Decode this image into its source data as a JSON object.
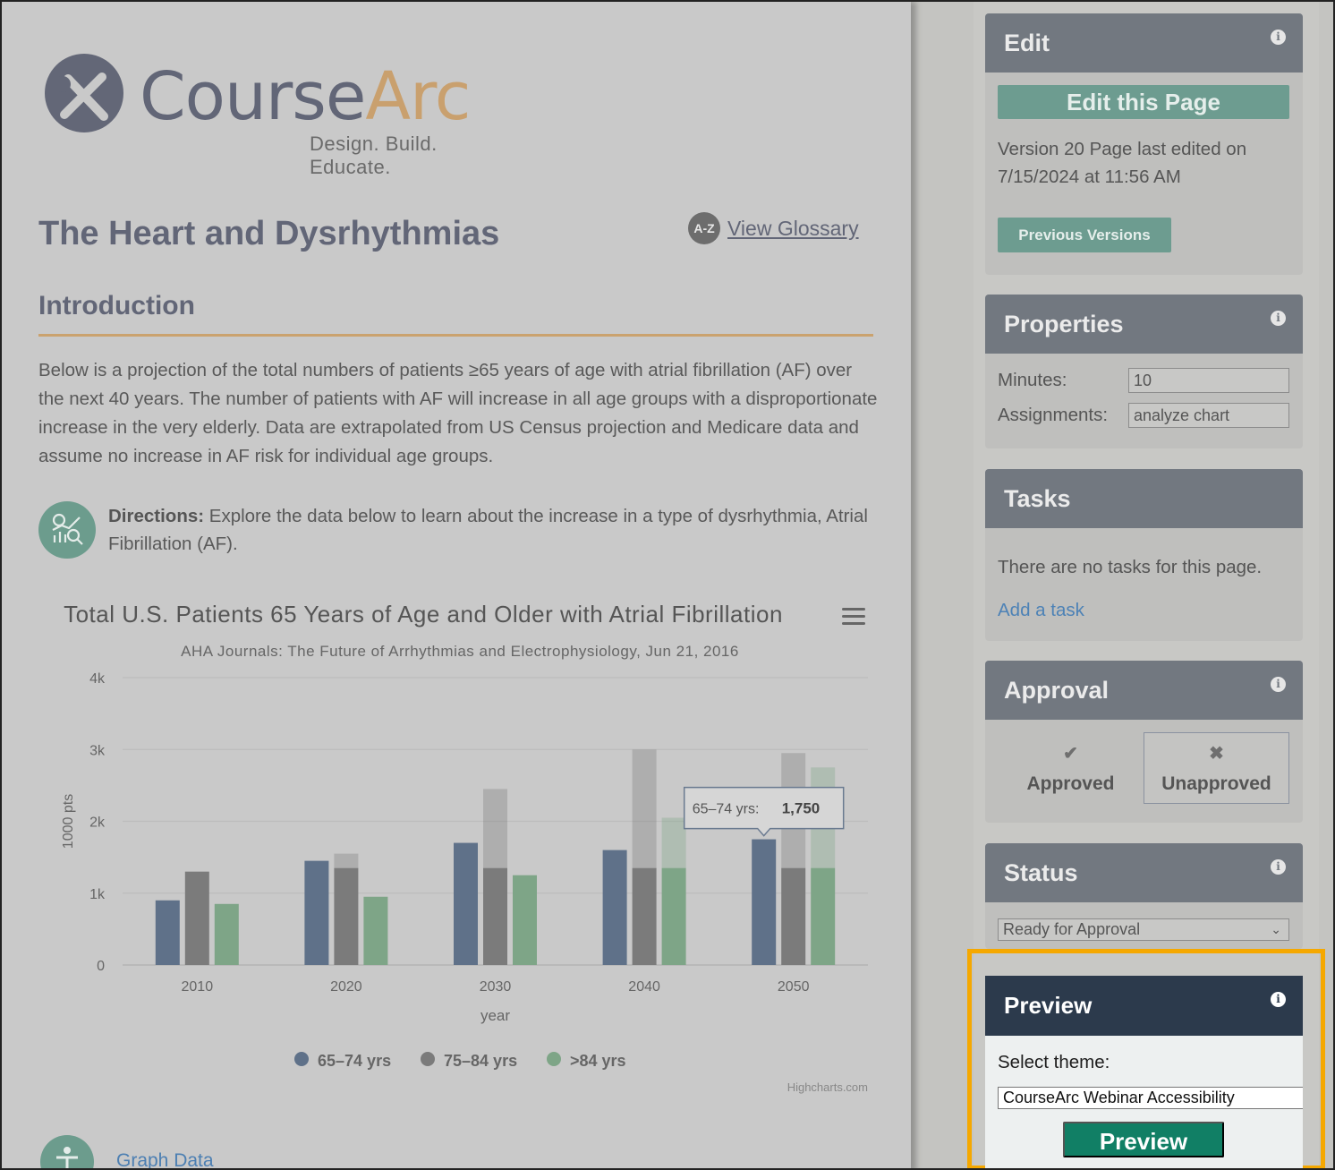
{
  "logo": {
    "word_course": "Course",
    "word_arc": "Arc",
    "tagline": "Design. Build. Educate."
  },
  "page": {
    "title": "The Heart and Dysrhythmias",
    "glossary_badge": "A-Z",
    "glossary_link": "View Glossary",
    "intro_heading": "Introduction",
    "intro_text": "Below is a projection of the total numbers of patients ≥65 years of age with atrial fibrillation (AF) over the next 40 years. The number of patients with AF will increase in all age groups with a disproportionate increase in the very elderly. Data are extrapolated from US Census projection and Medicare data and assume no increase in AF risk for individual age groups.",
    "directions_label": "Directions:",
    "directions_text": "Explore the data below to learn about the increase in a type of dysrhythmia, Atrial Fibrillation (AF).",
    "graph_data_link": "Graph Data"
  },
  "chart_data": {
    "type": "bar",
    "title": "Total U.S. Patients 65 Years of Age and Older with Atrial Fibrillation",
    "subtitle": "AHA Journals: The Future of Arrhythmias and Electrophysiology, Jun 21, 2016",
    "xlabel": "year",
    "ylabel": "1000 pts",
    "ylim": [
      0,
      4000
    ],
    "yticks": [
      "0",
      "1k",
      "2k",
      "3k",
      "4k"
    ],
    "categories": [
      "2010",
      "2020",
      "2030",
      "2040",
      "2050"
    ],
    "series": [
      {
        "name": "65–74 yrs",
        "color": "#5f7189",
        "values": [
          900,
          1450,
          1700,
          1600,
          1750
        ]
      },
      {
        "name": "75–84 yrs",
        "color": "#7b7b7b",
        "values": [
          1300,
          1550,
          2450,
          3000,
          2950
        ]
      },
      {
        "name": ">84 yrs",
        "color": "#7ea587",
        "values": [
          850,
          950,
          1250,
          2050,
          2750
        ]
      }
    ],
    "baseline_overlay": 1350,
    "legend_position": "bottom-center",
    "grid": true,
    "tooltip": {
      "label": "65–74 yrs:",
      "value": "1,750"
    },
    "credits": "Highcharts.com"
  },
  "sidebar": {
    "edit": {
      "title": "Edit",
      "edit_button": "Edit this Page",
      "version_text": "Version 20   Page last edited on 7/15/2024 at 11:56 AM",
      "previous_versions_button": "Previous Versions"
    },
    "properties": {
      "title": "Properties",
      "minutes_label": "Minutes:",
      "minutes_value": "10",
      "assignments_label": "Assignments:",
      "assignments_value": "analyze chart"
    },
    "tasks": {
      "title": "Tasks",
      "empty_text": "There are no tasks for this page.",
      "add_task_link": "Add a task"
    },
    "approval": {
      "title": "Approval",
      "approved_label": "Approved",
      "unapproved_label": "Unapproved"
    },
    "status": {
      "title": "Status",
      "selected": "Ready for Approval"
    },
    "preview": {
      "title": "Preview",
      "theme_label": "Select theme:",
      "theme_selected": "CourseArc Webinar Accessibility",
      "preview_button": "Preview"
    }
  },
  "colors": {
    "highlight_outline": "#f5a800",
    "teal_button": "#117f65",
    "panel_header": "#727880",
    "preview_header": "#2c3a4c"
  }
}
